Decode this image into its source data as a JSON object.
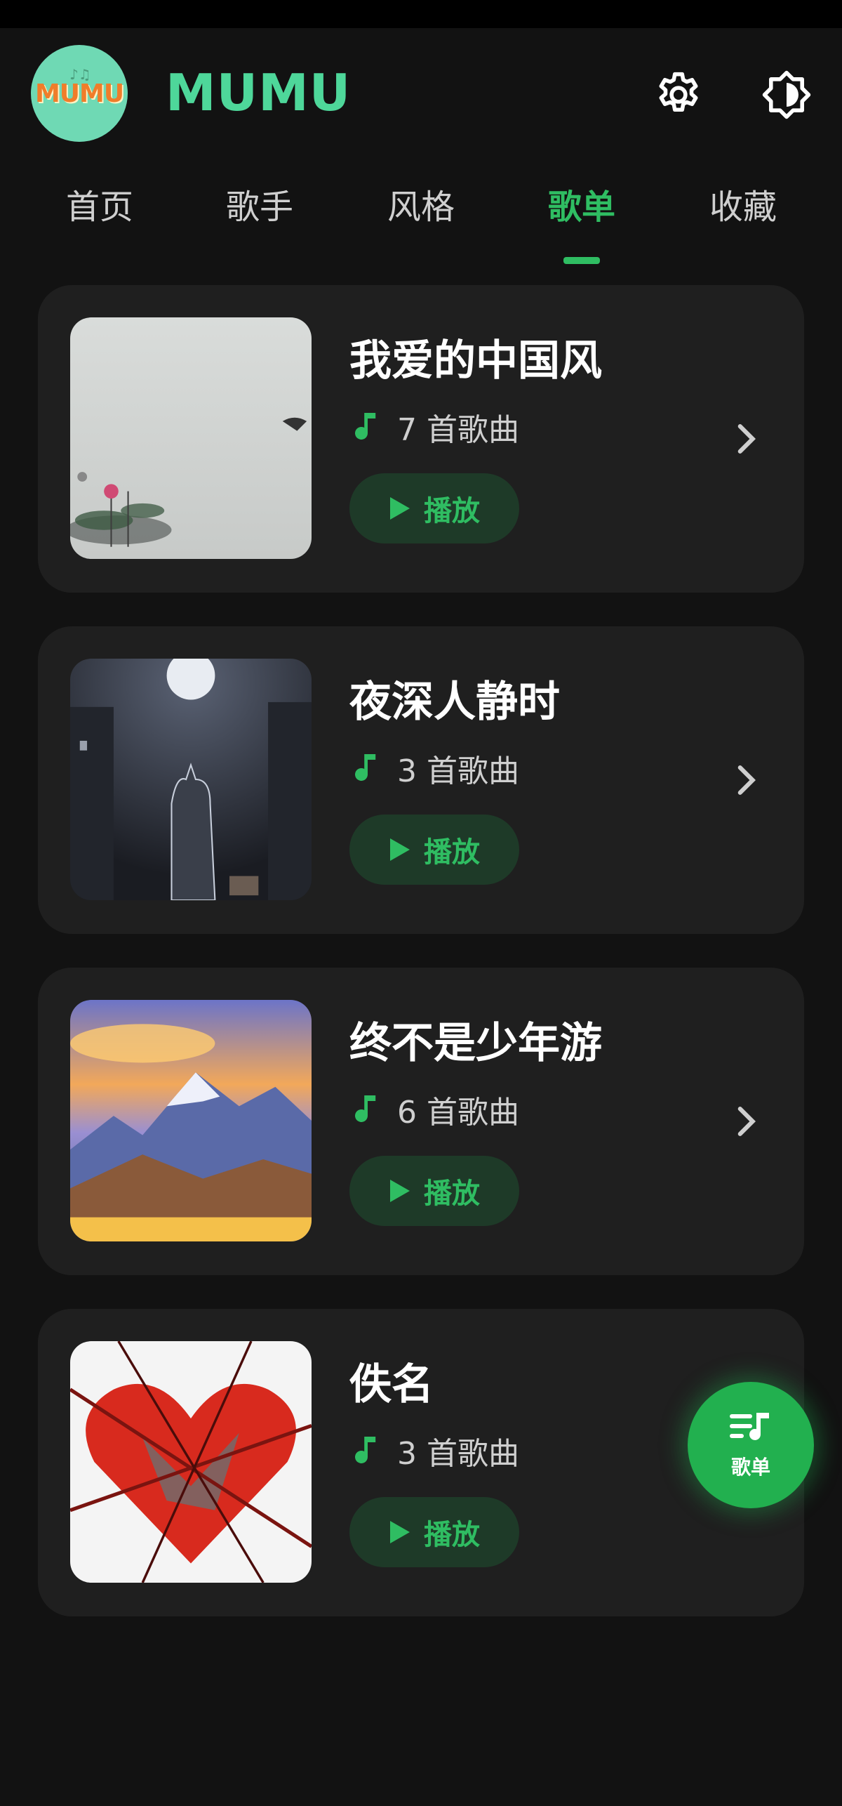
{
  "app": {
    "logo_text": "MUMU",
    "title": "MUMU"
  },
  "tabs": [
    {
      "label": "首页",
      "active": false
    },
    {
      "label": "歌手",
      "active": false
    },
    {
      "label": "风格",
      "active": false
    },
    {
      "label": "歌单",
      "active": true
    },
    {
      "label": "收藏",
      "active": false
    }
  ],
  "playlists": [
    {
      "name": "我爱的中国风",
      "count": "7 首歌曲",
      "play_label": "播放",
      "cover": "ink-lotus-painting"
    },
    {
      "name": "夜深人静时",
      "count": "3 首歌曲",
      "play_label": "播放",
      "cover": "cat-under-moon"
    },
    {
      "name": "终不是少年游",
      "count": "6 首歌曲",
      "play_label": "播放",
      "cover": "sunset-mountains"
    },
    {
      "name": "佚名",
      "count": "3 首歌曲",
      "play_label": "播放",
      "cover": "thorny-red-heart"
    }
  ],
  "fab": {
    "label": "歌单",
    "icon": "playlist-music-icon"
  },
  "colors": {
    "accent": "#2fbd62",
    "title": "#4ed79a",
    "background": "#121212",
    "card": "#1f1f1f"
  }
}
